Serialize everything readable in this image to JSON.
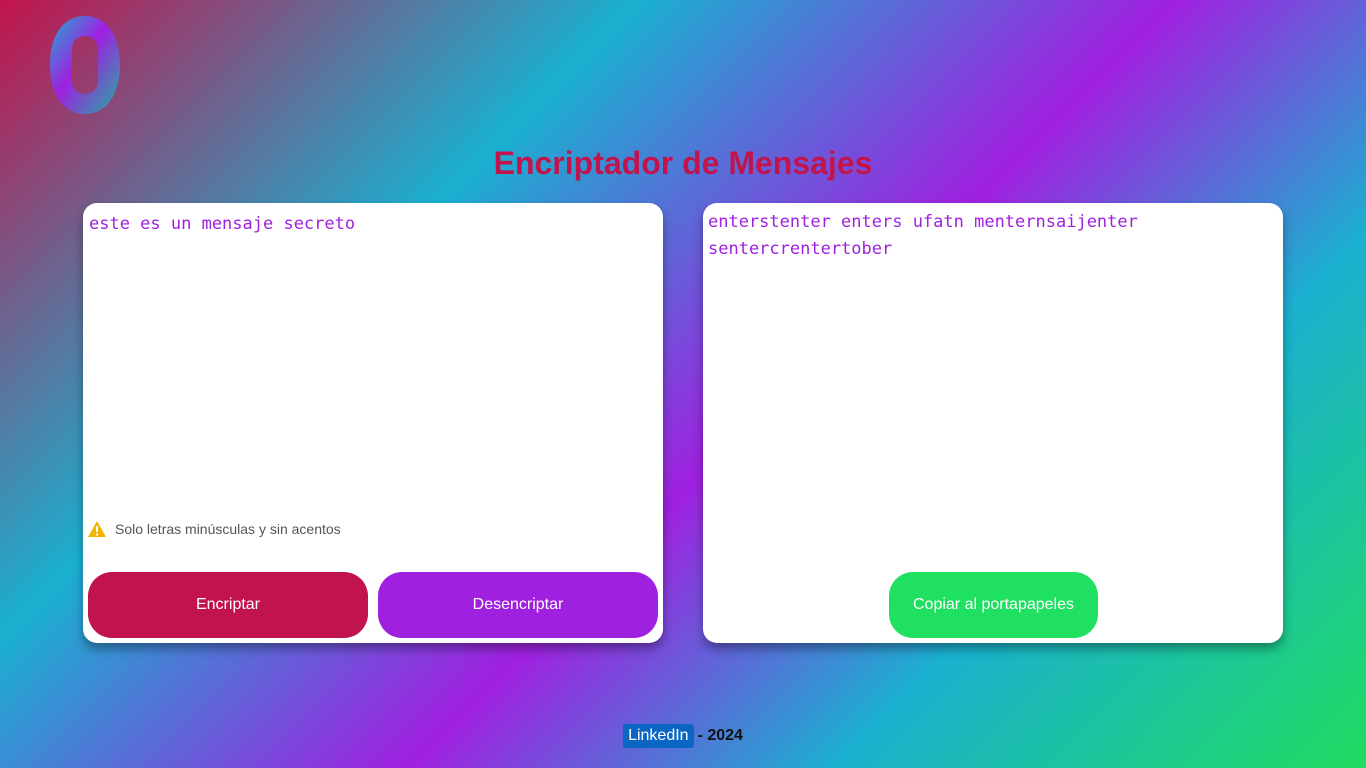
{
  "header": {
    "logo_icon": "gradient-ring-logo-icon",
    "title": "Encriptador de Mensajes"
  },
  "input_panel": {
    "value": "este es un mensaje secreto",
    "hint_icon": "warning-icon",
    "hint": "Solo letras minúsculas y sin acentos",
    "encrypt_label": "Encriptar",
    "decrypt_label": "Desencriptar"
  },
  "output_panel": {
    "text": "enterstenter enters ufatn menternsaijenter sentercrentertober",
    "copy_label": "Copiar al portapapeles"
  },
  "footer": {
    "link_label": "LinkedIn",
    "year": "- 2024"
  },
  "colors": {
    "title": "#c2144c",
    "encrypt_button": "#c2144c",
    "decrypt_button": "#a020e0",
    "copy_button": "#1fe060",
    "text_purple": "#a020e0",
    "linkedin": "#0a66c2"
  }
}
